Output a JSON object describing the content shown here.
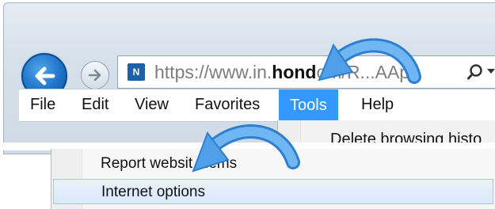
{
  "browser": {
    "url_prefix": "https://www.in.",
    "url_bold": "hond",
    "url_suffix": "om/R...AApp",
    "site_icon_text": "N",
    "icons": {
      "back": "back-arrow-icon",
      "forward": "forward-arrow-icon",
      "search": "search-icon",
      "dropdown": "chevron-down-icon"
    }
  },
  "menubar": {
    "items": [
      "File",
      "Edit",
      "View",
      "Favorites",
      "Tools",
      "Help"
    ],
    "active": "Tools",
    "active_color": "#3399ff"
  },
  "tools_menu": {
    "first_item_partial": "Delete browsing histo",
    "report_item": "Report websit   blems",
    "internet_options": "Internet options"
  },
  "annotations": {
    "arrow_color": "#5aa9ee"
  }
}
